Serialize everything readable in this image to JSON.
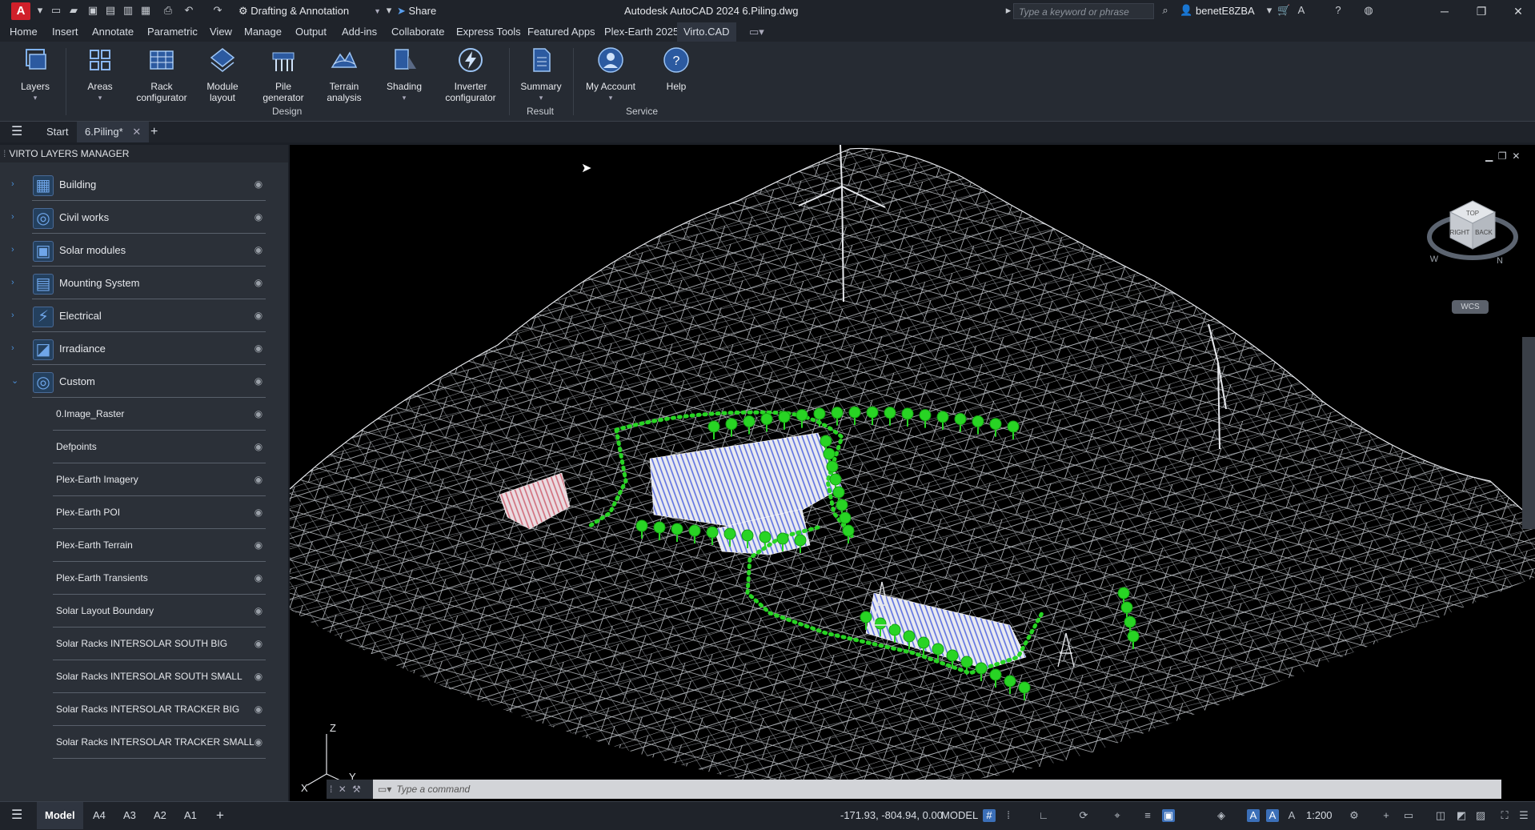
{
  "app": {
    "title": "Autodesk AutoCAD 2024    6.Piling.dwg",
    "logo_letter": "A",
    "workspace": "Drafting & Annotation",
    "share_label": "Share",
    "search_placeholder": "Type a keyword or phrase",
    "username": "benetE8ZBA"
  },
  "menu_tabs": [
    "Home",
    "Insert",
    "Annotate",
    "Parametric",
    "View",
    "Manage",
    "Output",
    "Add-ins",
    "Collaborate",
    "Express Tools",
    "Featured Apps",
    "Plex-Earth 2025",
    "Virto.CAD"
  ],
  "ribbon": {
    "buttons": [
      {
        "label1": "Layers",
        "label2": ""
      },
      {
        "label1": "Areas",
        "label2": ""
      },
      {
        "label1": "Rack",
        "label2": "configurator"
      },
      {
        "label1": "Module",
        "label2": "layout"
      },
      {
        "label1": "Pile",
        "label2": "generator"
      },
      {
        "label1": "Terrain",
        "label2": "analysis"
      },
      {
        "label1": "Shading",
        "label2": ""
      },
      {
        "label1": "Inverter",
        "label2": "configurator"
      },
      {
        "label1": "Summary",
        "label2": ""
      },
      {
        "label1": "My Account",
        "label2": ""
      },
      {
        "label1": "Help",
        "label2": ""
      }
    ],
    "groups": [
      "Design",
      "Result",
      "Service"
    ]
  },
  "doc_tabs": {
    "start": "Start",
    "active": "6.Piling*"
  },
  "panel": {
    "title": "VIRTO LAYERS MANAGER",
    "categories": [
      "Building",
      "Civil works",
      "Solar modules",
      "Mounting System",
      "Electrical",
      "Irradiance",
      "Custom"
    ],
    "custom_layers": [
      "0.Image_Raster",
      "Defpoints",
      "Plex-Earth Imagery",
      "Plex-Earth POI",
      "Plex-Earth Terrain",
      "Plex-Earth Transients",
      "Solar Layout Boundary",
      "Solar Racks INTERSOLAR SOUTH BIG",
      "Solar Racks INTERSOLAR SOUTH SMALL",
      "Solar Racks INTERSOLAR TRACKER BIG",
      "Solar Racks INTERSOLAR TRACKER SMALL"
    ]
  },
  "viewport": {
    "wcs_label": "WCS",
    "viewcube": {
      "top": "TOP",
      "right": "RIGHT",
      "back": "BACK",
      "north": "N",
      "west": "W"
    },
    "axes": {
      "x": "X",
      "y": "Y",
      "z": "Z"
    }
  },
  "command_placeholder": "Type a command",
  "status": {
    "layout_tabs": [
      "Model",
      "A4",
      "A3",
      "A2",
      "A1"
    ],
    "coordinates": "-171.93, -804.94, 0.00",
    "space": "MODEL",
    "scale": "1:200"
  },
  "colors": {
    "accent": "#3b6fb8",
    "vegetation": "#28d424",
    "panels_blue": "#5c6ee0",
    "panels_red": "#d06a7a"
  }
}
